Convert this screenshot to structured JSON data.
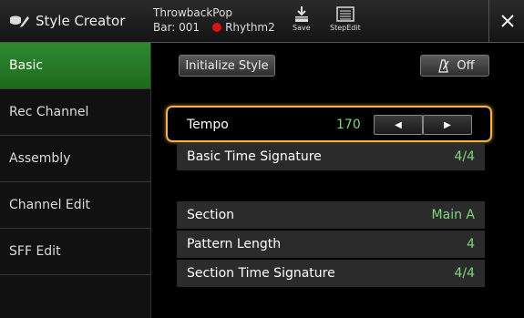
{
  "app": {
    "title": "Style Creator"
  },
  "song": {
    "name": "ThrowbackPop",
    "bar": "Bar: 001",
    "channel": "Rhythm2"
  },
  "toolbar": {
    "save_label": "Save",
    "stepedit_label": "StepEdit"
  },
  "sidebar": {
    "items": [
      {
        "label": "Basic",
        "active": true
      },
      {
        "label": "Rec Channel"
      },
      {
        "label": "Assembly"
      },
      {
        "label": "Channel Edit"
      },
      {
        "label": "SFF Edit"
      }
    ]
  },
  "main": {
    "initialize_label": "Initialize Style",
    "metronome_label": "Off",
    "tempo": {
      "label": "Tempo",
      "value": "170"
    },
    "basic_time_signature": {
      "label": "Basic Time Signature",
      "value": "4/4"
    },
    "section": {
      "label": "Section",
      "value": "Main A"
    },
    "pattern_length": {
      "label": "Pattern Length",
      "value": "4"
    },
    "section_time_signature": {
      "label": "Section Time Signature",
      "value": "4/4"
    }
  },
  "colors": {
    "accent_green": "#2f8a2f",
    "value_green": "#7dd87d",
    "highlight": "#f0b24a",
    "rec_red": "#e01010"
  }
}
